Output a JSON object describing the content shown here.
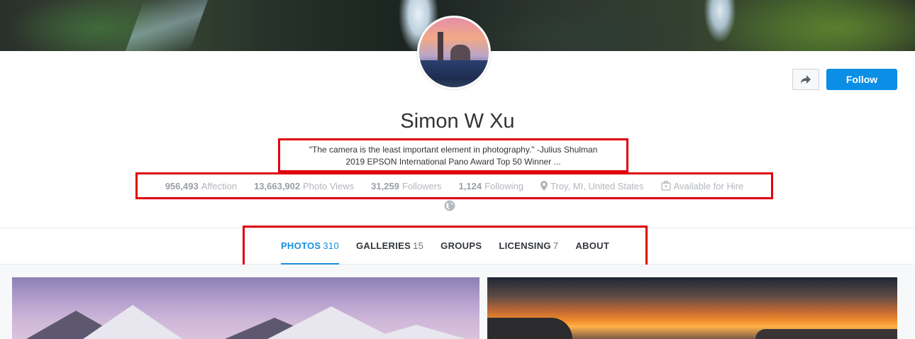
{
  "profile": {
    "name": "Simon W Xu",
    "bio_line1": "\"The camera is the least important element in photography.\" -Julius Shulman",
    "bio_line2": "2019 EPSON International Pano Award Top 50 Winner ..."
  },
  "actions": {
    "share_icon": "share-arrow-icon",
    "follow_label": "Follow"
  },
  "stats": {
    "affection_value": "956,493",
    "affection_label": "Affection",
    "photo_views_value": "13,663,902",
    "photo_views_label": "Photo Views",
    "followers_value": "31,259",
    "followers_label": "Followers",
    "following_value": "1,124",
    "following_label": "Following",
    "location": "Troy, MI, United States",
    "hire": "Available for Hire"
  },
  "tabs": [
    {
      "label": "PHOTOS",
      "count": "310",
      "active": true
    },
    {
      "label": "GALLERIES",
      "count": "15",
      "active": false
    },
    {
      "label": "GROUPS",
      "count": "",
      "active": false
    },
    {
      "label": "LICENSING",
      "count": "7",
      "active": false
    },
    {
      "label": "ABOUT",
      "count": "",
      "active": false
    }
  ],
  "colors": {
    "accent": "#1a8fdd",
    "follow_button": "#0b8ee6",
    "highlight_box": "#e0000f"
  }
}
